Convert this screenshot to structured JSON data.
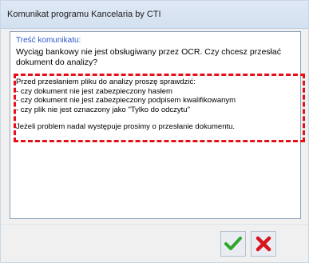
{
  "window": {
    "title": "Komunikat programu Kancelaria by CTI"
  },
  "panel": {
    "section_label": "Treść komunikatu:",
    "message_line1": "Wyciąg bankowy nie jest obsługiwany przez OCR. Czy chcesz przesłać",
    "message_line2": "dokument do analizy?",
    "details": {
      "intro": "Przed przesłaniem pliku do analizy proszę sprawdzić:",
      "check1": "- czy dokument nie jest zabezpieczony hasłem",
      "check2": "- czy dokument nie jest zabezpieczony podpisem kwalifikowanym",
      "check3": "- czy plik nie jest oznaczony jako \"Tylko do odczytu\"",
      "footer": "Jeżeli problem nadal występuje prosimy o przesłanie dokumentu."
    }
  },
  "buttons": {
    "ok_icon": "checkmark-icon",
    "cancel_icon": "close-x-icon"
  },
  "colors": {
    "highlight": "#e3101a",
    "ok": "#2fa62a",
    "cancel": "#d9141c",
    "section_label": "#2b58c9"
  }
}
